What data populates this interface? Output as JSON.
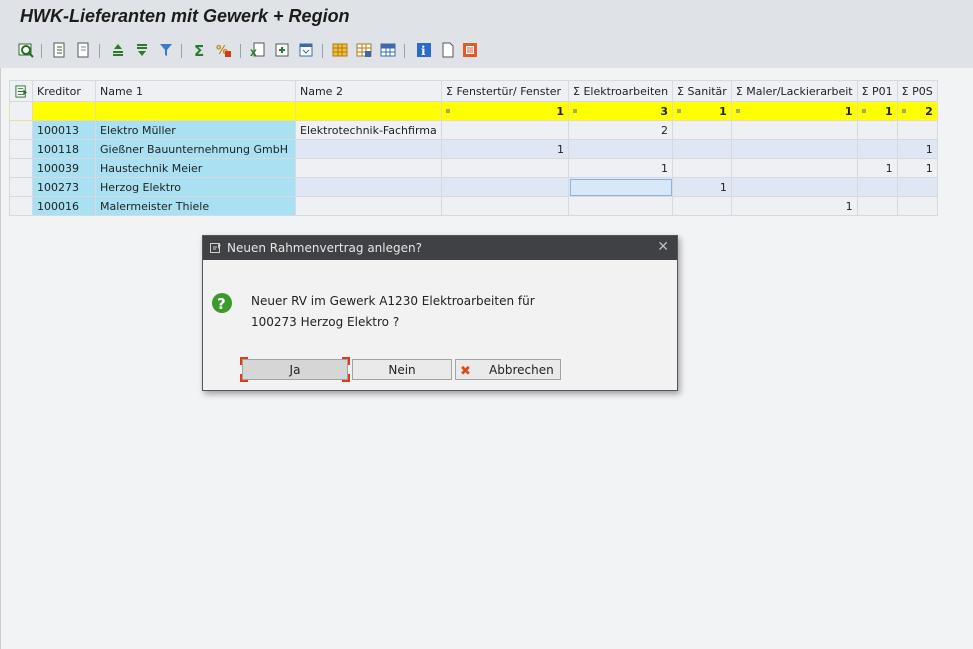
{
  "window": {
    "title": "HWK-Lieferanten mit Gewerk +  Region"
  },
  "toolbar": {
    "icons": [
      "details-icon",
      "first-page-icon",
      "last-page-icon",
      "sort-ascending-icon",
      "sort-descending-icon",
      "filter-icon",
      "total-icon",
      "subtotal-icon",
      "export-icon",
      "print-preview-icon",
      "layout-icon",
      "change-layout-icon",
      "choose-layout-icon",
      "save-layout-icon",
      "info-icon",
      "new-document-icon",
      "report-icon"
    ]
  },
  "grid": {
    "columns": [
      "Kreditor",
      "Name 1",
      "Name 2",
      "Σ Fenstertür/ Fenster",
      "Σ Elektroarbeiten",
      "Σ Sanitär",
      "Σ Maler/Lackierarbeit",
      "Σ P01",
      "Σ P0S"
    ],
    "totals": [
      "1",
      "3",
      "1",
      "1",
      "1",
      "2"
    ],
    "rows": [
      {
        "kreditor": "100013",
        "name1": "Elektro Müller",
        "name2": "Elektrotechnik-Fachfirma",
        "fenster": "",
        "elektro": "2",
        "sanitaer": "",
        "maler": "",
        "p01": "",
        "p0s": ""
      },
      {
        "kreditor": "100118",
        "name1": "Gießner Bauunternehmung GmbH",
        "name2": "",
        "fenster": "1",
        "elektro": "",
        "sanitaer": "",
        "maler": "",
        "p01": "",
        "p0s": "1"
      },
      {
        "kreditor": "100039",
        "name1": "Haustechnik Meier",
        "name2": "",
        "fenster": "",
        "elektro": "1",
        "sanitaer": "",
        "maler": "",
        "p01": "1",
        "p0s": "1"
      },
      {
        "kreditor": "100273",
        "name1": "Herzog Elektro",
        "name2": "",
        "fenster": "",
        "elektro": "",
        "sanitaer": "1",
        "maler": "",
        "p01": "",
        "p0s": ""
      },
      {
        "kreditor": "100016",
        "name1": "Malermeister Thiele",
        "name2": "",
        "fenster": "",
        "elektro": "",
        "sanitaer": "",
        "maler": "1",
        "p01": "",
        "p0s": ""
      }
    ]
  },
  "dialog": {
    "title": "Neuen Rahmenvertrag anlegen?",
    "close": "✕",
    "message_line1": "Neuer RV im Gewerk A1230 Elektroarbeiten für",
    "message_line2": "100273 Herzog Elektro ?",
    "buttons": {
      "yes": "Ja",
      "no": "Nein",
      "cancel": "Abbrechen"
    }
  }
}
